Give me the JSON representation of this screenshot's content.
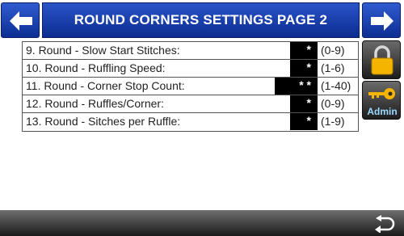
{
  "header": {
    "title": "ROUND CORNERS SETTINGS PAGE 2",
    "prev_icon": "arrow-left-icon",
    "next_icon": "arrow-right-icon"
  },
  "settings": [
    {
      "label": "9.  Round - Slow Start Stitches:",
      "value": "*",
      "range": "(0-9)"
    },
    {
      "label": "10. Round - Ruffling Speed:",
      "value": "*",
      "range": "(1-6)"
    },
    {
      "label": "11. Round - Corner Stop Count:",
      "value": "* *",
      "range": "(1-40)"
    },
    {
      "label": "12. Round - Ruffles/Corner:",
      "value": "*",
      "range": "(0-9)"
    },
    {
      "label": "13. Round - Sitches per Ruffle:",
      "value": "*",
      "range": "(1-9)"
    }
  ],
  "side": {
    "lock_icon": "lock-icon",
    "admin_icon": "key-icon",
    "admin_label": "Admin"
  },
  "footer": {
    "back_icon": "return-arrow-icon"
  },
  "colors": {
    "title_bar": "#1f44b8",
    "value_bg": "#000000",
    "lock": "#f4b400",
    "admin_text": "#9ad8ff"
  }
}
